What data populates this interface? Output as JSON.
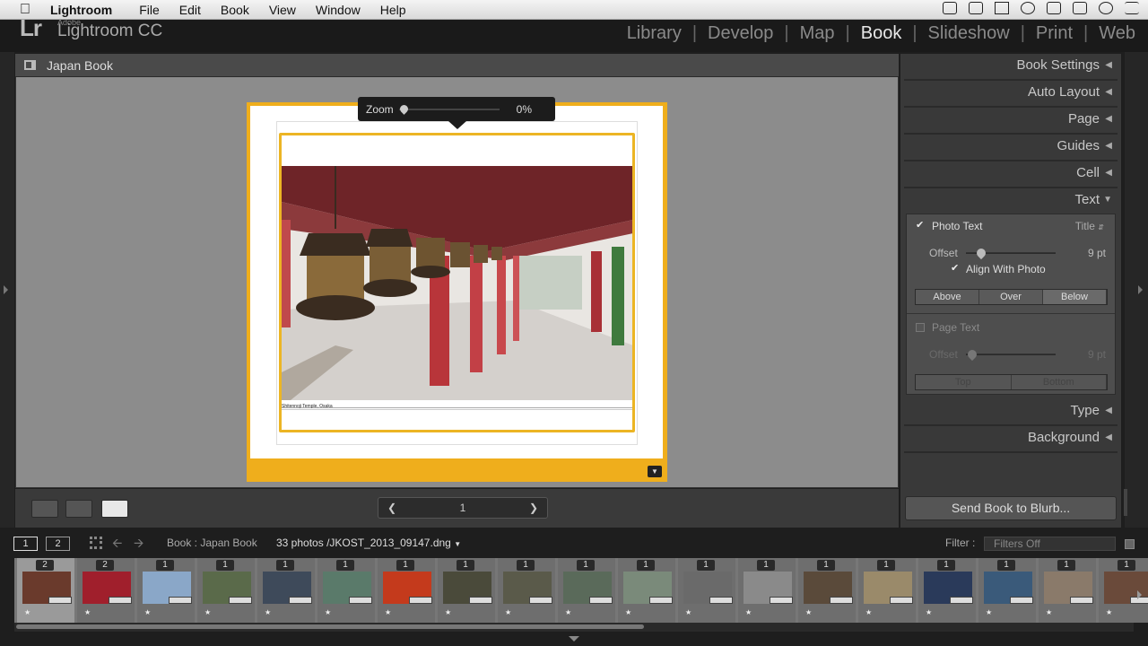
{
  "menubar": {
    "app": "Lightroom",
    "items": [
      "File",
      "Edit",
      "Book",
      "View",
      "Window",
      "Help"
    ]
  },
  "brand": {
    "adobe": "Adobe",
    "product": "Lightroom CC",
    "mark": "Lr"
  },
  "modules": [
    "Library",
    "Develop",
    "Map",
    "Book",
    "Slideshow",
    "Print",
    "Web"
  ],
  "active_module": "Book",
  "center": {
    "title": "Japan Book"
  },
  "zoom": {
    "label": "Zoom",
    "value": "0%"
  },
  "page": {
    "caption": "Shitennoji Temple, Osaka",
    "page_number": "1"
  },
  "right_panel": {
    "sections_top": [
      "Book Settings",
      "Auto Layout",
      "Page",
      "Guides",
      "Cell",
      "Text"
    ],
    "sections_bottom": [
      "Type",
      "Background"
    ],
    "text": {
      "photo_text_label": "Photo Text",
      "photo_text_checked": true,
      "photo_text_mode": "Title",
      "offset_label": "Offset",
      "offset_value": "9 pt",
      "align_label": "Align With Photo",
      "align_checked": true,
      "positions": [
        "Above",
        "Over",
        "Below"
      ],
      "position_selected": "Below",
      "page_text_label": "Page Text",
      "page_text_checked": false,
      "page_offset_label": "Offset",
      "page_offset_value": "9 pt",
      "page_positions": [
        "Top",
        "Bottom"
      ]
    },
    "send_button": "Send Book to Blurb..."
  },
  "filmstrip_bar": {
    "screen1": "1",
    "screen2": "2",
    "source": "Book : Japan Book",
    "count": "33 photos",
    "file": "/JKOST_2013_09147.dng",
    "filter_label": "Filter :",
    "filter_value": "Filters Off"
  },
  "thumbnails": [
    {
      "count": "2",
      "color": "#6a3a2c",
      "selected": true
    },
    {
      "count": "2",
      "color": "#a01f2c"
    },
    {
      "count": "1",
      "color": "#8aa7c8"
    },
    {
      "count": "1",
      "color": "#5a6a4a"
    },
    {
      "count": "1",
      "color": "#3e4a5a"
    },
    {
      "count": "1",
      "color": "#5a7a6a"
    },
    {
      "count": "1",
      "color": "#c43a1c"
    },
    {
      "count": "1",
      "color": "#4a4a3a"
    },
    {
      "count": "1",
      "color": "#5a5a4a"
    },
    {
      "count": "1",
      "color": "#5a6a5a"
    },
    {
      "count": "1",
      "color": "#7a8a7a"
    },
    {
      "count": "1",
      "color": "#6a6a6a"
    },
    {
      "count": "1",
      "color": "#8a8a8a"
    },
    {
      "count": "1",
      "color": "#5a4a3a"
    },
    {
      "count": "1",
      "color": "#9a8a6a"
    },
    {
      "count": "1",
      "color": "#2a3a5a"
    },
    {
      "count": "1",
      "color": "#3a5a7a"
    },
    {
      "count": "1",
      "color": "#8a7a6a"
    },
    {
      "count": "1",
      "color": "#6a4a3a"
    }
  ]
}
